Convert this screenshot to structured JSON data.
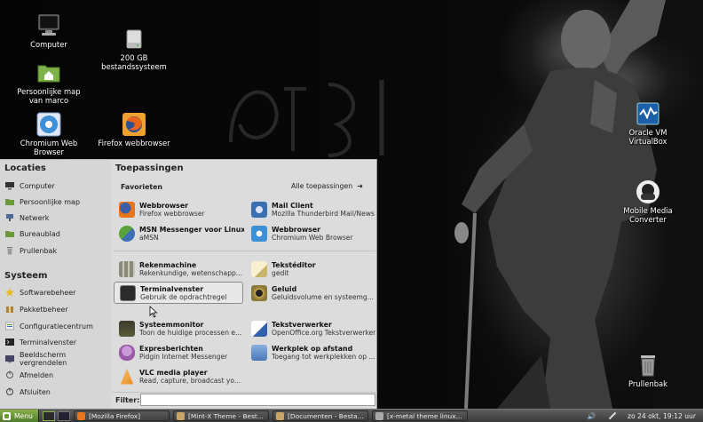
{
  "desktop": {
    "icons": [
      {
        "label": "Computer"
      },
      {
        "label": "200 GB\nbestandssysteem"
      },
      {
        "label": "Persoonlijke map\nvan marco"
      },
      {
        "label": "Chromium Web\nBrowser"
      },
      {
        "label": "Firefox webbrowser"
      },
      {
        "label": "Oracle VM\nVirtualBox"
      },
      {
        "label": "Mobile Media\nConverter"
      },
      {
        "label": "Prullenbak"
      }
    ]
  },
  "menu": {
    "locations_title": "Locaties",
    "locations": [
      "Computer",
      "Persoonlijke map",
      "Netwerk",
      "Bureaublad",
      "Prullenbak"
    ],
    "system_title": "Systeem",
    "system": [
      "Softwarebeheer",
      "Pakketbeheer",
      "Configuratiecentrum",
      "Terminalvenster",
      "Beeldscherm vergrendelen",
      "Afmelden",
      "Afsluiten"
    ],
    "apps_title": "Toepassingen",
    "favorites_label": "Favorieten",
    "all_apps_label": "Alle toepassingen",
    "apps": [
      {
        "title": "Webbrowser",
        "desc": "Firefox webbrowser",
        "color": "#e8741c"
      },
      {
        "title": "Mail Client",
        "desc": "Mozilla Thunderbird Mail/News",
        "color": "#3d6fb5"
      },
      {
        "title": "MSN Messenger voor Linux",
        "desc": "aMSN",
        "color": "#5aa23a"
      },
      {
        "title": "Webbrowser",
        "desc": "Chromium Web Browser",
        "color": "#3d8fd6"
      },
      {
        "title": "Rekenmachine",
        "desc": "Rekenkundige, wetenschapp...",
        "color": "#8a8a7a"
      },
      {
        "title": "Tekstéditor",
        "desc": "gedit",
        "color": "#c9b56a"
      },
      {
        "title": "Terminalvenster",
        "desc": "Gebruik de opdrachtregel",
        "color": "#2b2b2b"
      },
      {
        "title": "Geluid",
        "desc": "Geluidsvolume en systeemg...",
        "color": "#8a7a3a"
      },
      {
        "title": "Systeemmonitor",
        "desc": "Toon de huidige processen e...",
        "color": "#3b3b2b"
      },
      {
        "title": "Tekstverwerker",
        "desc": "OpenOffice.org Tekstverwerker",
        "color": "#2f62a8"
      },
      {
        "title": "Expresberichten",
        "desc": "Pidgin Internet Messenger",
        "color": "#9a5aa8"
      },
      {
        "title": "Werkplek op afstand",
        "desc": "Toegang tot werkplekken op ...",
        "color": "#4a78b8"
      },
      {
        "title": "VLC media player",
        "desc": "Read, capture, broadcast yo...",
        "color": "#e88a1c"
      }
    ],
    "filter_label": "Filter:",
    "filter_value": ""
  },
  "panel": {
    "menu_label": "Menu",
    "tasks": [
      {
        "label": "[Mozilla Firefox]",
        "color": "#e8741c"
      },
      {
        "label": "[Mint-X Theme - Best...",
        "color": "#c9a56a"
      },
      {
        "label": "[Documenten - Besta...",
        "color": "#c9a56a"
      },
      {
        "label": "[x-metal theme linux...",
        "color": "#a8a8a8"
      }
    ],
    "clock": "zo 24 okt, 19:12 uur"
  },
  "colors": {
    "menu_bg": "#dcdcdc",
    "panel_bg": "#4a4a4a",
    "mint_green": "#6a9a3a"
  }
}
